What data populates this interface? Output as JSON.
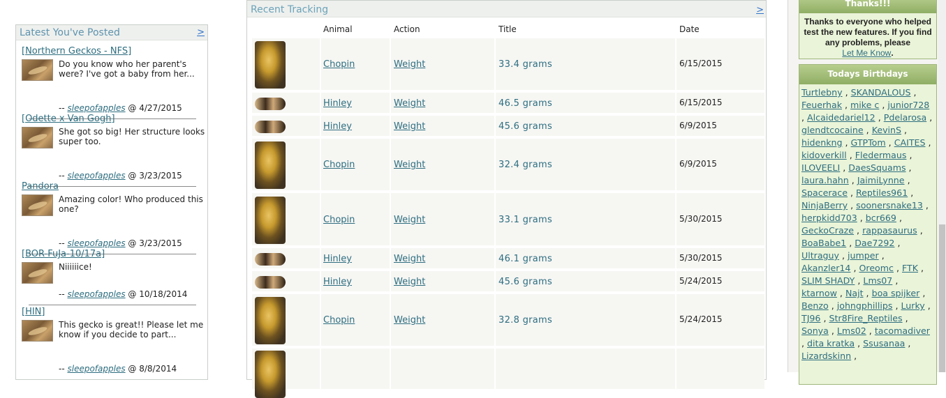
{
  "latest": {
    "title": "Latest You've Posted",
    "more": ">",
    "posts": [
      {
        "title": "[Northern Geckos - NFS]",
        "text": "Do you know who her parent's were? I've got a baby from her...",
        "prefix": "--",
        "user": "sleepofapples",
        "date": "@ 4/27/2015"
      },
      {
        "title": "[Odette x Van Gogh]",
        "text": "She got so big! Her structure looks super too.",
        "prefix": "--",
        "user": "sleepofapples",
        "date": "@ 3/23/2015"
      },
      {
        "title": "Pandora",
        "text": "Amazing color! Who produced this one?",
        "prefix": "--",
        "user": "sleepofapples",
        "date": "@ 3/23/2015"
      },
      {
        "title": "[BOR-FuJa-10/17a]",
        "text": "Niiiiiice!",
        "prefix": "--",
        "user": "sleepofapples",
        "date": "@ 10/18/2014"
      },
      {
        "title": "[HIN]",
        "text": "This gecko is great!! Please let me know if you decide to part...",
        "prefix": "--",
        "user": "sleepofapples",
        "date": "@ 8/8/2014"
      }
    ]
  },
  "tracking": {
    "title": "Recent Tracking",
    "more": ">",
    "headers": {
      "animal": "Animal",
      "action": "Action",
      "title": "Title",
      "date": "Date"
    },
    "rows": [
      {
        "animal": "Chopin",
        "action": "Weight",
        "title": "33.4 grams",
        "date": "6/15/2015",
        "thumb": "big"
      },
      {
        "animal": "Hinley",
        "action": "Weight",
        "title": "46.5 grams",
        "date": "6/15/2015",
        "thumb": "small"
      },
      {
        "animal": "Hinley",
        "action": "Weight",
        "title": "45.6 grams",
        "date": "6/9/2015",
        "thumb": "small"
      },
      {
        "animal": "Chopin",
        "action": "Weight",
        "title": "32.4 grams",
        "date": "6/9/2015",
        "thumb": "big"
      },
      {
        "animal": "Chopin",
        "action": "Weight",
        "title": "33.1 grams",
        "date": "5/30/2015",
        "thumb": "big"
      },
      {
        "animal": "Hinley",
        "action": "Weight",
        "title": "46.1 grams",
        "date": "5/30/2015",
        "thumb": "small"
      },
      {
        "animal": "Hinley",
        "action": "Weight",
        "title": "45.6 grams",
        "date": "5/24/2015",
        "thumb": "small"
      },
      {
        "animal": "Chopin",
        "action": "Weight",
        "title": "32.8 grams",
        "date": "5/24/2015",
        "thumb": "big"
      },
      {
        "animal": "",
        "action": "",
        "title": "",
        "date": "",
        "thumb": "big"
      }
    ]
  },
  "thanks": {
    "header": "Thanks!!!",
    "text": "Thanks to everyone who helped test the new features. If you find any problems, please",
    "link": "Let Me Know",
    "after": "."
  },
  "birthdays": {
    "header": "Todays Birthdays",
    "names": [
      "Turtlebny",
      "SKANDALOUS",
      "Feuerhak",
      "mike c",
      "junior728",
      "Alcaidedariel12",
      "Pdelarosa",
      "glendtcocaine",
      "KevinS",
      "hidenkng",
      "GTPTom",
      "CAITES",
      "kidoverkill",
      "Fledermaus",
      "ILOVEELI",
      "DaesSquams",
      "laura.hahn",
      "JaimiLynne",
      "Spacerace",
      "Reptiles961",
      "NinjaBerry",
      "soonersnake13",
      "herpkidd703",
      "bcr669",
      "GeckoCraze",
      "rappasaurus",
      "BoaBabe1",
      "Dae7292",
      "Ultraguy",
      "jumper",
      "Akanzler14",
      "Oreomc",
      "FTK",
      "SLIM SHADY",
      "Lms07",
      "ktarnow",
      "Najt",
      "boa spijker",
      "Benzo",
      "johngphillips",
      "Lurky",
      "TJ96",
      "Str8Fire_Reptiles",
      "Sonya",
      "Lms02",
      "tacomadiver",
      "dita kratka",
      "Ssusanaa",
      "Lizardskinn"
    ],
    "separator": ","
  },
  "colors": {
    "link": "#2e6e80",
    "panel_title": "#5f93ad",
    "green_header": "#8fae64",
    "green_bg": "#eaf4d8"
  }
}
